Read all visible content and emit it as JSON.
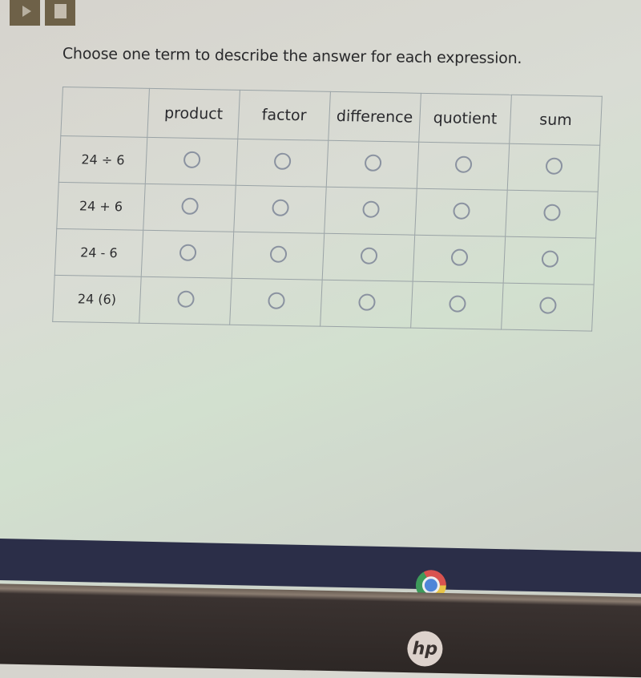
{
  "media_controls": {
    "play_icon": "play-icon",
    "stop_icon": "stop-icon"
  },
  "instructions": "Choose one term to describe the answer for each expression.",
  "grid": {
    "columns": [
      "",
      "product",
      "factor",
      "difference",
      "quotient",
      "sum"
    ],
    "rows": [
      {
        "expression": "24 ÷ 6",
        "selected": null
      },
      {
        "expression": "24 + 6",
        "selected": null
      },
      {
        "expression": "24 - 6",
        "selected": null
      },
      {
        "expression": "24 (6)",
        "selected": null
      }
    ]
  },
  "taskbar": {
    "apps": [
      {
        "name": "Chrome",
        "icon": "chrome-icon",
        "active": true
      }
    ]
  },
  "bezel": {
    "logo": "hp"
  },
  "colors": {
    "taskbar": "#2b2e48",
    "radio_border": "#8a92a0",
    "grid_border": "#9aa3a6",
    "media_button": "#6e6148"
  }
}
